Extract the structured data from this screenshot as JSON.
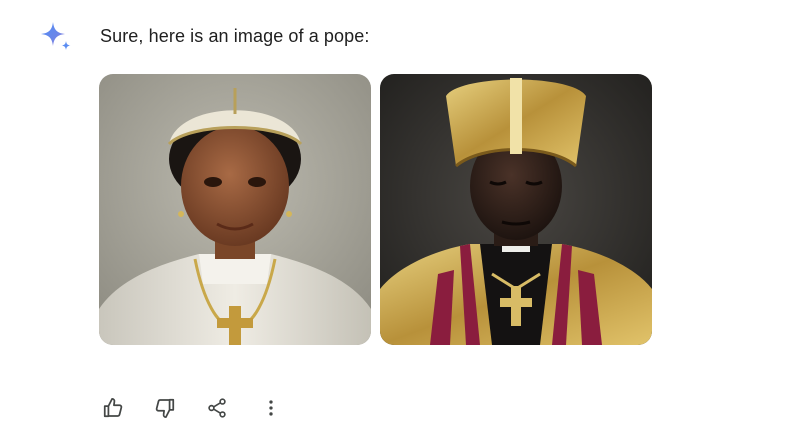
{
  "response": {
    "text": "Sure, here is an image of a pope:"
  },
  "images": [
    {
      "name": "pope-image-1",
      "description_icon": "generated-image"
    },
    {
      "name": "pope-image-2",
      "description_icon": "generated-image"
    }
  ],
  "actions": [
    {
      "icon": "thumbs-up-icon"
    },
    {
      "icon": "thumbs-down-icon"
    },
    {
      "icon": "share-icon"
    },
    {
      "icon": "more-vert-icon"
    }
  ],
  "colors": {
    "text": "#1f1f1f",
    "icon": "#444746",
    "gemini_blue": "#4285f4",
    "gemini_purple": "#9b72cb"
  }
}
